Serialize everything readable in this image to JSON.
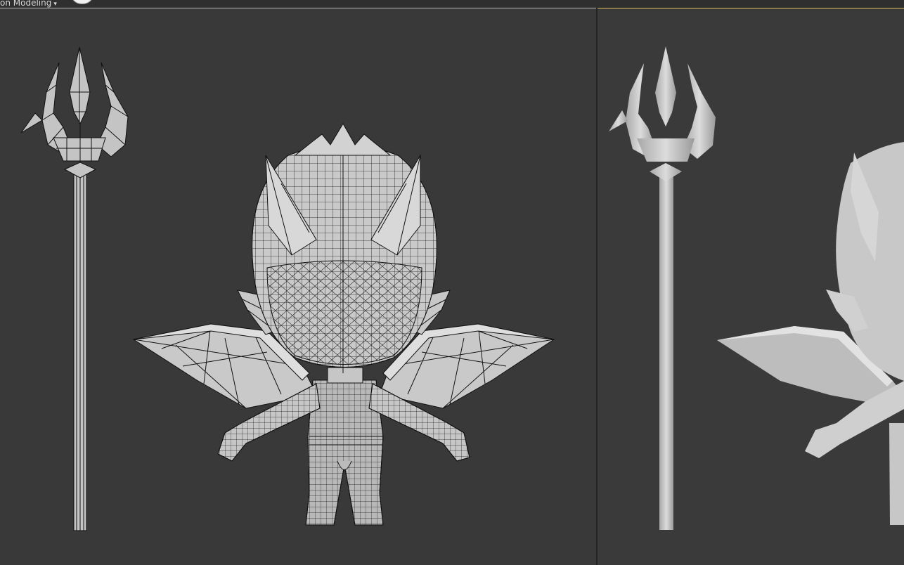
{
  "toolbar": {
    "ribbon_tab_label": "on Modeling",
    "dropdown_glyph": "▾"
  },
  "viewports": {
    "left": {
      "mode": "wireframe-on-shaded"
    },
    "right": {
      "mode": "shaded"
    }
  },
  "colors": {
    "viewport_bg": "#393939",
    "mesh_fill": "#bdbdbd",
    "wire": "#111111",
    "active_border": "#8a7a4a"
  }
}
